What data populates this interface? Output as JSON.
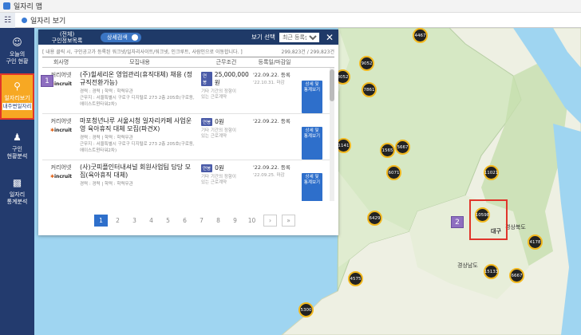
{
  "window": {
    "title": "일자리 맵"
  },
  "tab": {
    "label": "일자리 보기"
  },
  "sidebar": {
    "items": [
      {
        "label": "오늘의\n구인 현황"
      },
      {
        "label": "일자리보기",
        "sub": "내주변일자리"
      },
      {
        "label": "구인\n현황분석"
      },
      {
        "label": "일자리\n통계분석"
      }
    ]
  },
  "panel": {
    "header_title": "(전체)\n구인정보목록",
    "toggle_label": "상세검색",
    "view_label": "보기 선택",
    "view_option": "최근 등록순",
    "notice": "[ 내용 클릭 시, 구인공고가 등록된 워크넷/일자리사이트/워크넷, 인크루트, 사람인으로 이동합니다. ]",
    "count": "299,823건 / 299,823건",
    "columns": [
      "회사명",
      "모집내용",
      "근무조건",
      "등록일/마감일",
      ""
    ],
    "rows": [
      {
        "company": "커리어넷",
        "logo": "incruit",
        "title": "(주)힐세리온 영업관리(휴직대체) 채용 (정규직전환가능)",
        "meta": "경력 : 경력 | 학력 : 학력무관\n근무지 : 서울특별시 구로구 디지털로 273 2층 205호(구로동, 에이스트윈타워2차)",
        "badge": "연봉",
        "pay": "25,000,000원",
        "extra": "기타 기간의 정함이\n있는 근로계약",
        "reg": "'22.09.22. 등록",
        "end": "'22.10.31. 마감",
        "btn": "상세 및\n통계보기"
      },
      {
        "company": "커리어넷",
        "logo": "incruit",
        "title": "마포청년나루 서울시청 일자리카페 사업운영 육아휴직 대체 모집(파견X)",
        "meta": "경력 : 경력 | 학력 : 학력무관\n근무지 : 서울특별시 구로구 디지털로 273 2층 205호(구로동, 에이스트윈타워2차)",
        "badge": "연봉",
        "pay": "0원",
        "extra": "기타 기간의 정함이\n있는 근로계약",
        "reg": "'22.09.22. 등록",
        "end": "",
        "btn": "상세 및\n통계보기"
      },
      {
        "company": "커리어넷",
        "logo": "incruit",
        "title": "(사)굿피플인터내셔널 회원사업팀 담당 모집(육아휴직 대체)",
        "meta": "경력 : 경력 | 학력 : 학력무관",
        "badge": "연봉",
        "pay": "0원",
        "extra": "기타 기간의 정함이\n있는 근로계약",
        "reg": "'22.09.22. 등록",
        "end": "'22.09.25. 마감",
        "btn": "상세 및\n통계보기"
      }
    ],
    "pages": [
      "1",
      "2",
      "3",
      "4",
      "5",
      "6",
      "7",
      "8",
      "9",
      "10"
    ],
    "next": "›",
    "last": "»"
  },
  "markers": {
    "one": "1",
    "two": "2"
  },
  "map": {
    "clusters": [
      "4467",
      "9052",
      "7861",
      "8052",
      "1141",
      "1565",
      "5667",
      "6071",
      "11021",
      "6429",
      "10598",
      "4178",
      "4575",
      "15133",
      "6667",
      "5300"
    ],
    "cities": [
      "대구",
      "경상남도",
      "경상북도"
    ]
  }
}
